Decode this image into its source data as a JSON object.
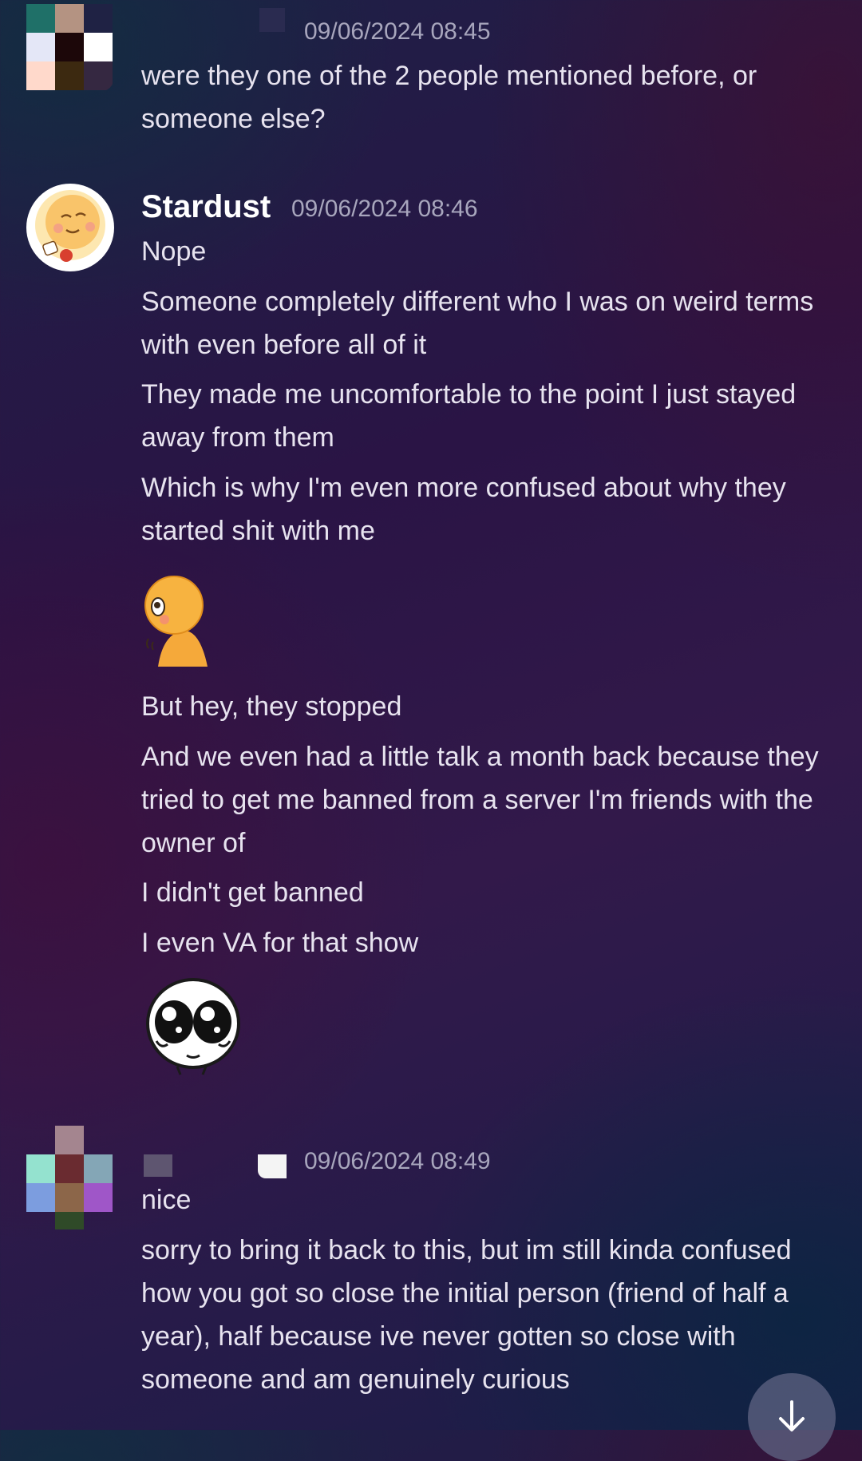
{
  "messages": [
    {
      "author": "",
      "timestamp": "09/06/2024 08:45",
      "lines": [
        "were they one of the 2 people mentioned before, or someone else?"
      ]
    },
    {
      "author": "Stardust",
      "timestamp": "09/06/2024 08:46",
      "lines": [
        "Nope",
        "Someone completely different who I was on weird terms with even before all of it",
        "They made me uncomfortable to the point I just stayed away from them",
        "Which is why I'm even more confused about why they started shit with me",
        "But hey, they stopped",
        "And we even had a little talk a month back because they tried to get me banned from a server I'm friends with the owner of",
        "I didn't get banned",
        "I even VA for that show"
      ],
      "stickers": [
        "peeking-orange-character-sticker",
        "crying-eyes-face-sticker"
      ]
    },
    {
      "author": "",
      "timestamp": "09/06/2024 08:49",
      "lines": [
        "nice",
        "sorry to bring it back to this, but im still kinda confused how you got so close the initial person (friend of half a year), half because ive never gotten so close with someone and am genuinely curious"
      ]
    }
  ],
  "icons": {
    "scroll_down": "arrow-down-icon"
  },
  "colors": {
    "accent_orange": "#f5a93a",
    "timestamp": "#a8a6bd",
    "text": "#e7e3ef",
    "scroll_button": "#5c6280"
  }
}
